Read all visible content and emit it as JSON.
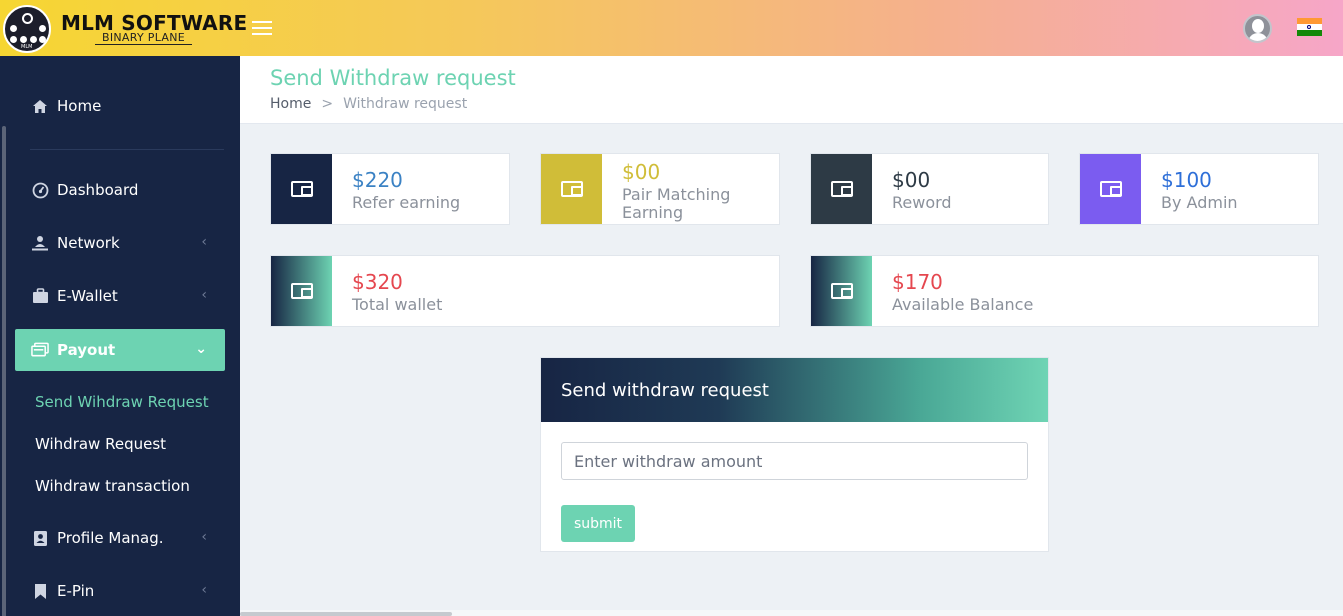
{
  "brand": {
    "title": "MLM SOFTWARE",
    "subtitle": "BINARY PLANE",
    "logo_text": "MLM"
  },
  "header": {
    "menu_icon": "hamburger-icon",
    "avatar_icon": "user-avatar-icon",
    "flag_icon": "india-flag-icon"
  },
  "sidebar": {
    "items": [
      {
        "label": "Home",
        "icon": "home-icon"
      },
      {
        "label": "Dashboard",
        "icon": "dashboard-icon"
      },
      {
        "label": "Network",
        "icon": "network-icon"
      },
      {
        "label": "E-Wallet",
        "icon": "briefcase-icon"
      },
      {
        "label": "Payout",
        "icon": "payout-icon"
      },
      {
        "label": "Profile Manag.",
        "icon": "profile-icon"
      },
      {
        "label": "E-Pin",
        "icon": "bookmark-icon"
      }
    ],
    "payout_sub": [
      "Send Wihdraw Request",
      "Wihdraw Request",
      "Wihdraw transaction"
    ]
  },
  "page": {
    "title": "Send Withdraw request",
    "breadcrumb": {
      "home": "Home",
      "separator": ">",
      "current": "Withdraw request"
    }
  },
  "cards": [
    {
      "value": "$220",
      "label": "Refer earning",
      "icon_bg": "#172544",
      "value_color": "#3b82c4"
    },
    {
      "value": "$00",
      "label": "Pair Matching Earning",
      "icon_bg": "#d0bd38",
      "value_color": "#d0bd38"
    },
    {
      "value": "$00",
      "label": "Reword",
      "icon_bg": "#2d3a45",
      "value_color": "#2d3a45"
    },
    {
      "value": "$100",
      "label": "By Admin",
      "icon_bg": "#7b5cf0",
      "value_color": "#2e6fd8"
    },
    {
      "value": "$320",
      "label": "Total wallet",
      "value_color": "#e5474f"
    },
    {
      "value": "$170",
      "label": "Available Balance",
      "value_color": "#e5474f"
    }
  ],
  "form": {
    "title": "Send withdraw request",
    "amount_placeholder": "Enter withdraw amount",
    "submit_label": "submit"
  },
  "colors": {
    "accent": "#6dd3b2",
    "sidebar_bg": "#172544"
  }
}
